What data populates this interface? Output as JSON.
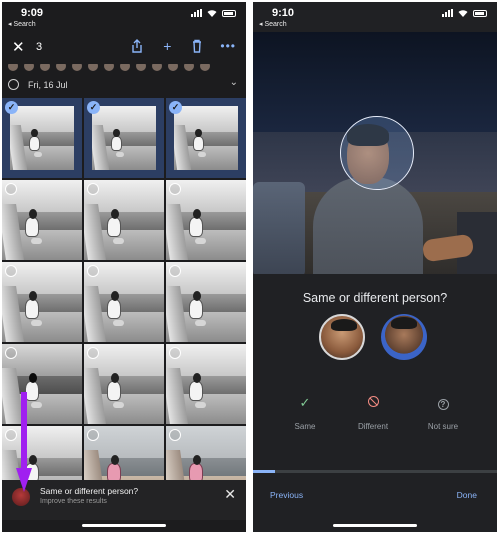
{
  "left_screen": {
    "status": {
      "time": "9:09",
      "back_label": "◂ Search"
    },
    "toolbar": {
      "close_icon": "close-icon",
      "selected_count": "3",
      "icons": [
        "share-icon",
        "add-icon",
        "delete-icon",
        "more-icon"
      ]
    },
    "date_header": {
      "label": "Fri, 16 Jul"
    },
    "photos": [
      {
        "selected": true,
        "tone": "bw"
      },
      {
        "selected": true,
        "tone": "bw"
      },
      {
        "selected": true,
        "tone": "bw"
      },
      {
        "selected": false,
        "tone": "bw"
      },
      {
        "selected": false,
        "tone": "bw"
      },
      {
        "selected": false,
        "tone": "bw"
      },
      {
        "selected": false,
        "tone": "bw"
      },
      {
        "selected": false,
        "tone": "bw"
      },
      {
        "selected": false,
        "tone": "bw"
      },
      {
        "selected": false,
        "tone": "dark"
      },
      {
        "selected": false,
        "tone": "bw"
      },
      {
        "selected": false,
        "tone": "bw"
      },
      {
        "selected": false,
        "tone": "bw"
      },
      {
        "selected": false,
        "tone": "color"
      },
      {
        "selected": false,
        "tone": "color"
      }
    ],
    "snackbar": {
      "title": "Same or different person?",
      "subtitle": "Improve these results"
    },
    "annotation_arrow_color": "#a020f0"
  },
  "right_screen": {
    "status": {
      "time": "9:10",
      "back_label": "◂ Search"
    },
    "question": "Same or different person?",
    "choices": {
      "same": "Same",
      "different": "Different",
      "not_sure": "Not sure"
    },
    "progress_fraction": 0.09,
    "nav": {
      "previous": "Previous",
      "done": "Done"
    },
    "accent_color": "#8ab4f8"
  }
}
